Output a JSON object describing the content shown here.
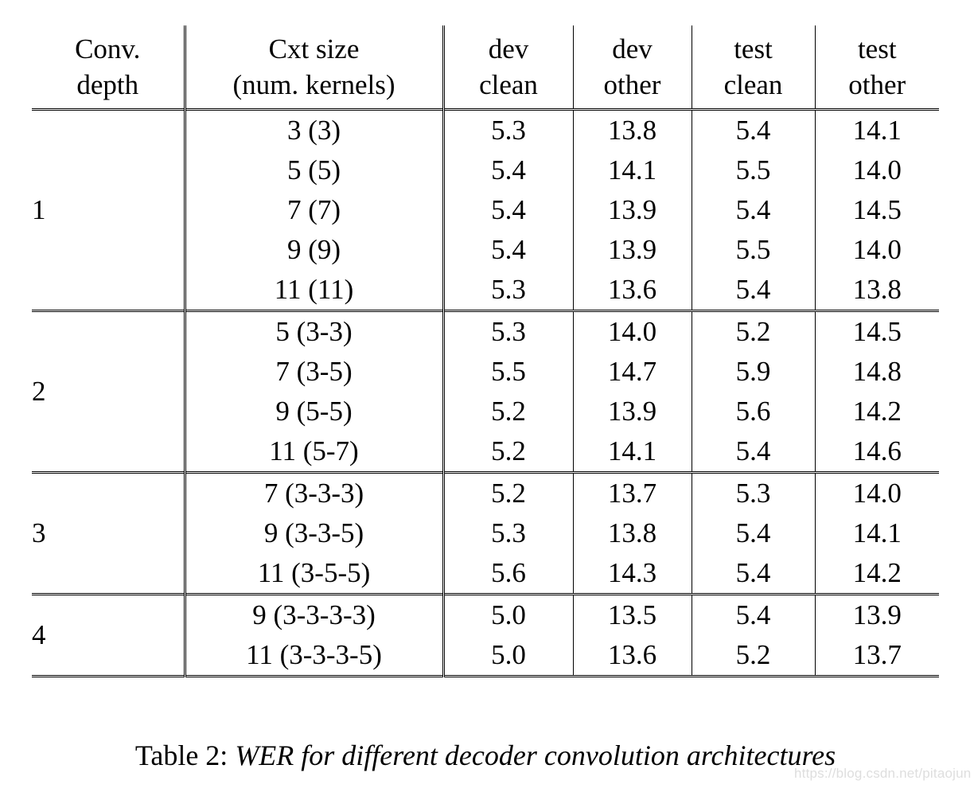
{
  "table": {
    "headers": {
      "depth": {
        "line1": "Conv.",
        "line2": "depth"
      },
      "cxt": {
        "line1": "Cxt size",
        "line2": "(num. kernels)"
      },
      "dev_clean": {
        "line1": "dev",
        "line2": "clean"
      },
      "dev_other": {
        "line1": "dev",
        "line2": "other"
      },
      "test_clean": {
        "line1": "test",
        "line2": "clean"
      },
      "test_other": {
        "line1": "test",
        "line2": "other"
      }
    },
    "blocks": [
      {
        "depth": "1",
        "rows": [
          {
            "cxt": "3 (3)",
            "dev_clean": "5.3",
            "dev_other": "13.8",
            "test_clean": "5.4",
            "test_other": "14.1"
          },
          {
            "cxt": "5 (5)",
            "dev_clean": "5.4",
            "dev_other": "14.1",
            "test_clean": "5.5",
            "test_other": "14.0"
          },
          {
            "cxt": "7 (7)",
            "dev_clean": "5.4",
            "dev_other": "13.9",
            "test_clean": "5.4",
            "test_other": "14.5"
          },
          {
            "cxt": "9 (9)",
            "dev_clean": "5.4",
            "dev_other": "13.9",
            "test_clean": "5.5",
            "test_other": "14.0"
          },
          {
            "cxt": "11 (11)",
            "dev_clean": "5.3",
            "dev_other": "13.6",
            "test_clean": "5.4",
            "test_other": "13.8"
          }
        ]
      },
      {
        "depth": "2",
        "rows": [
          {
            "cxt": "5 (3-3)",
            "dev_clean": "5.3",
            "dev_other": "14.0",
            "test_clean": "5.2",
            "test_other": "14.5"
          },
          {
            "cxt": "7 (3-5)",
            "dev_clean": "5.5",
            "dev_other": "14.7",
            "test_clean": "5.9",
            "test_other": "14.8"
          },
          {
            "cxt": "9 (5-5)",
            "dev_clean": "5.2",
            "dev_other": "13.9",
            "test_clean": "5.6",
            "test_other": "14.2"
          },
          {
            "cxt": "11 (5-7)",
            "dev_clean": "5.2",
            "dev_other": "14.1",
            "test_clean": "5.4",
            "test_other": "14.6"
          }
        ]
      },
      {
        "depth": "3",
        "rows": [
          {
            "cxt": "7 (3-3-3)",
            "dev_clean": "5.2",
            "dev_other": "13.7",
            "test_clean": "5.3",
            "test_other": "14.0"
          },
          {
            "cxt": "9 (3-3-5)",
            "dev_clean": "5.3",
            "dev_other": "13.8",
            "test_clean": "5.4",
            "test_other": "14.1"
          },
          {
            "cxt": "11 (3-5-5)",
            "dev_clean": "5.6",
            "dev_other": "14.3",
            "test_clean": "5.4",
            "test_other": "14.2"
          }
        ]
      },
      {
        "depth": "4",
        "rows": [
          {
            "cxt": "9 (3-3-3-3)",
            "dev_clean": "5.0",
            "dev_other": "13.5",
            "test_clean": "5.4",
            "test_other": "13.9"
          },
          {
            "cxt": "11 (3-3-3-5)",
            "dev_clean": "5.0",
            "dev_other": "13.6",
            "test_clean": "5.2",
            "test_other": "13.7"
          }
        ]
      }
    ]
  },
  "caption": {
    "label": "Table 2:",
    "text": "WER for different decoder convolution architectures"
  },
  "watermark": {
    "text": "https://blog.csdn.net/pitaojun"
  },
  "colors": {
    "rule": "#000000",
    "text": "#000000",
    "background": "#ffffff",
    "watermark": "#dedede"
  }
}
